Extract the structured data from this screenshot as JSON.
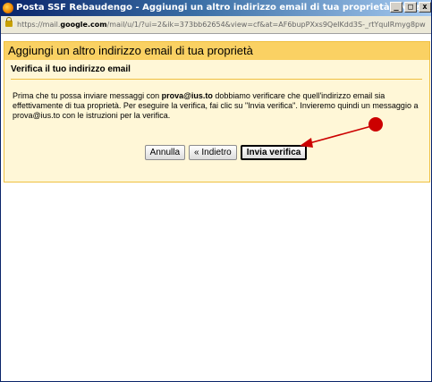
{
  "window": {
    "title": "Posta SSF Rebaudengo - Aggiungi un altro indirizzo email di tua proprietà - Mozilla Firefox",
    "minimize_glyph": "_",
    "maximize_glyph": "□",
    "close_glyph": "x"
  },
  "urlbar": {
    "url_prefix": "https://mail.",
    "url_domain": "google.com",
    "url_rest": "/mail/u/1/?ui=2&ik=373bb62654&view=cf&at=AF6bupPXxs9QeIKdd3S-_rtYquIRmyg8pw"
  },
  "dialog": {
    "header": "Aggiungi un altro indirizzo email di tua proprietà",
    "section_title": "Verifica il tuo indirizzo email",
    "message_part1": "Prima che tu possa inviare messaggi con ",
    "message_email": "prova@ius.to",
    "message_part2": " dobbiamo verificare che quell'indirizzo email sia effettivamente di tua proprietà. Per eseguire la verifica, fai clic su \"Invia verifica\". Invieremo quindi un messaggio a prova@ius.to con le istruzioni per la verifica.",
    "buttons": {
      "cancel": "Annulla",
      "back": "« Indietro",
      "send": "Invia verifica"
    }
  },
  "colors": {
    "header_bg": "#fad163",
    "dialog_bg": "#fff7d7",
    "annotation": "#cc0000"
  }
}
